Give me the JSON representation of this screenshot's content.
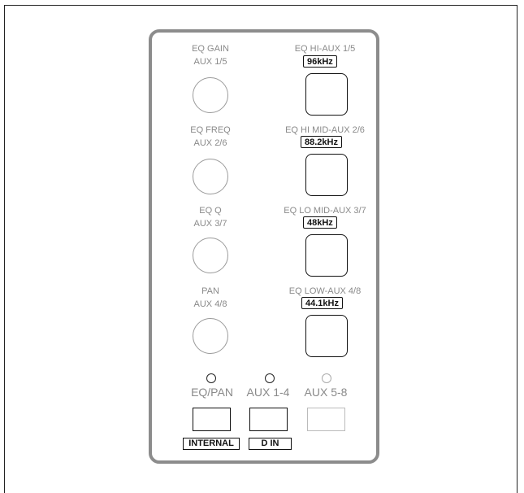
{
  "left_controls": [
    {
      "line1": "EQ GAIN",
      "line2": "AUX 1/5"
    },
    {
      "line1": "EQ FREQ",
      "line2": "AUX 2/6"
    },
    {
      "line1": "EQ Q",
      "line2": "AUX 3/7"
    },
    {
      "line1": "PAN",
      "line2": "AUX 4/8"
    }
  ],
  "right_controls": [
    {
      "label": "EQ HI-AUX 1/5",
      "rate": "96kHz"
    },
    {
      "label": "EQ HI MID-AUX 2/6",
      "rate": "88.2kHz"
    },
    {
      "label": "EQ LO MID-AUX 3/7",
      "rate": "48kHz"
    },
    {
      "label": "EQ LOW-AUX 4/8",
      "rate": "44.1kHz"
    }
  ],
  "selectors": [
    {
      "label": "EQ/PAN",
      "led_lit": true
    },
    {
      "label": "AUX 1-4",
      "led_lit": true
    },
    {
      "label": "AUX 5-8",
      "led_lit": false
    }
  ],
  "clock_tags": [
    "INTERNAL",
    "D IN"
  ],
  "colors": {
    "panel_border": "#8c8c8c",
    "label_text": "#8a8a8a",
    "line": "#111111"
  }
}
